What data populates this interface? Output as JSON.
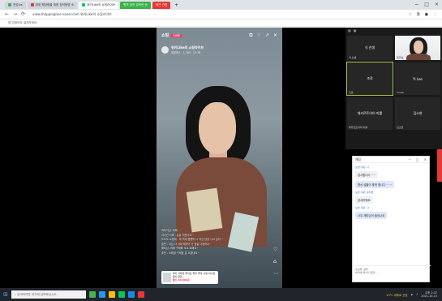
{
  "browser": {
    "tabs": [
      {
        "label": "전업ivs",
        "state": "normal"
      },
      {
        "label": "위위 웨딩링을 위한 정석탐방 소",
        "state": "normal"
      },
      {
        "label": "위키Like의 쇼핑라이브",
        "state": "active"
      },
      {
        "label": "원격 강의 강의안 공",
        "state": "green"
      },
      {
        "label": "퇴근 관련",
        "state": "red"
      }
    ],
    "url": "view.shoppinglive.naver.com 위키Like의 쇼핑라이브",
    "bookmark_text": "앱 업데이트 설치하세요",
    "window_controls": [
      "−",
      "□",
      "×"
    ]
  },
  "live": {
    "logo": "쇼핑",
    "badge": "LIVE",
    "channel_name": "위키Like의 쇼핑라이브",
    "channel_meta": "위클래스 · 1,780 · 12:38",
    "chat_lines": [
      "바둑이님: 최애 ...",
      "아이언 리파 · 유유 처왔어요~",
      "도도도 쇼핑네 : 아 이제 찜했어 나 지금 당장 사고 싶어 ~",
      "솔빈 : 지금 나 이제 예약이 가 정말 다양하다~",
      "해피님: 위해 구매확 오교 요해요~",
      "추천 : 오래할 구매할 분 오겠네요~"
    ],
    "product": {
      "text": "의미 가득한 좋아요 좋아 좋아 사랑 하나로 준비 완료~",
      "price": "할인 18,000원"
    }
  },
  "gallery": {
    "tiles": [
      {
        "label": "식 선생",
        "caption": "식 선생"
      },
      {
        "label": "",
        "caption": "위키님"
      },
      {
        "label": "조료",
        "caption": "조료",
        "active": true
      },
      {
        "label": "Yi Lee",
        "caption": "Yi Lee"
      },
      {
        "label": "데카르트아이 마를",
        "caption": "데카르트아이 마를"
      },
      {
        "label": "김소현",
        "caption": "김소현"
      }
    ]
  },
  "chat": {
    "title": "채팅",
    "messages": [
      {
        "from": "보낸 사람: 나",
        "text": "감사합니다 ~~",
        "mine": false
      },
      {
        "from": "",
        "text": "항상 설을이 좋게 합니다 ~ ~",
        "mine": true
      },
      {
        "from": "보낸 사람: 유지현",
        "text": "",
        "mine": false
      },
      {
        "from": "",
        "text": "공세지웨요",
        "mine": false
      },
      {
        "from": "보낸 사람: 나",
        "text": "",
        "mine": false
      },
      {
        "from": "",
        "text": "너무 재미있어 들었나요",
        "mine": true
      }
    ],
    "foot_to_label": "수신자:",
    "foot_to_value": "모두",
    "foot_placeholder": "여기에 메시지 입력..."
  },
  "taskbar": {
    "search_placeholder": "검색하려면 여기에 입력하십시오.",
    "weather": "23°C 대체로 흐림",
    "time": "오후 2:37",
    "date": "2021-10-15"
  }
}
